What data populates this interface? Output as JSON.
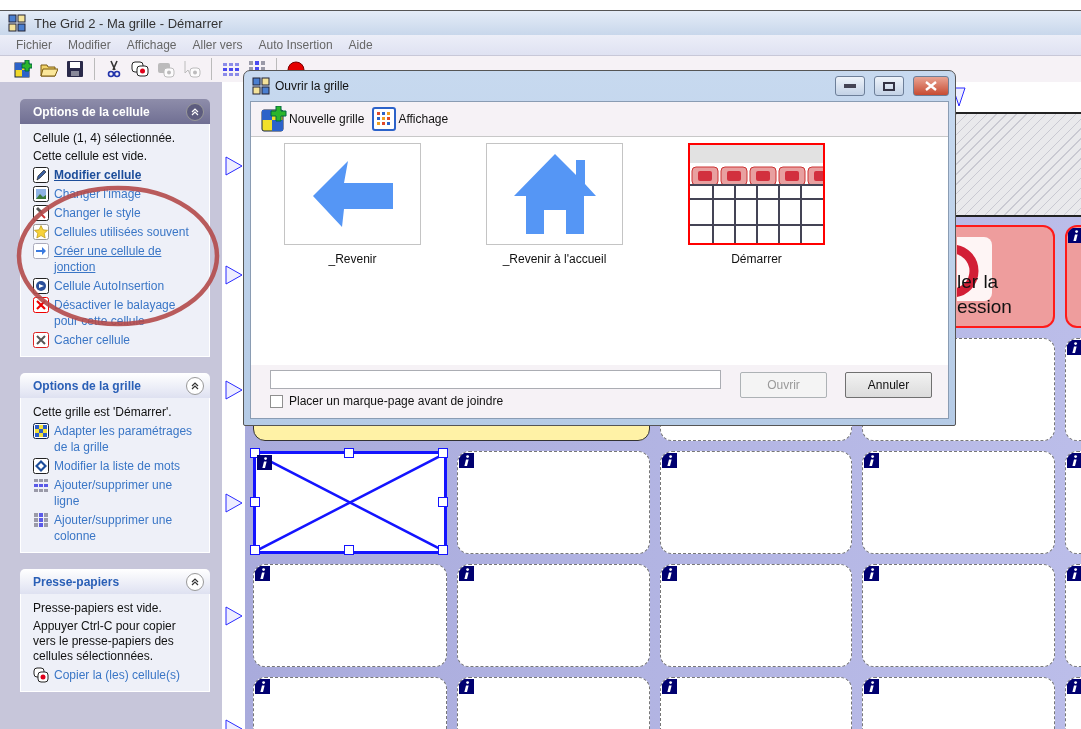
{
  "window": {
    "title": "The Grid 2 - Ma grille - Démarrer"
  },
  "menu": [
    "Fichier",
    "Modifier",
    "Affichage",
    "Aller vers",
    "Auto Insertion",
    "Aide"
  ],
  "toolbar": [
    {
      "kind": "button",
      "disabled": false
    },
    {
      "kind": "button",
      "disabled": false
    },
    {
      "kind": "button",
      "disabled": false
    },
    {
      "kind": "separator"
    },
    {
      "kind": "button",
      "disabled": false
    },
    {
      "kind": "button",
      "disabled": false
    },
    {
      "kind": "button",
      "disabled": true
    },
    {
      "kind": "button",
      "disabled": true
    },
    {
      "kind": "separator"
    },
    {
      "kind": "button",
      "disabled": false
    },
    {
      "kind": "button",
      "disabled": false
    },
    {
      "kind": "separator"
    },
    {
      "kind": "button",
      "disabled": false
    }
  ],
  "sidebar": {
    "panels": [
      {
        "title": "Options de la cellule",
        "focused": true,
        "texts": [
          "Cellule (1, 4) sélectionnée.",
          "Cette cellule est vide."
        ],
        "links": [
          {
            "label": "Modifier cellule",
            "default": true,
            "hovered": false
          },
          {
            "label": "Changer l'image",
            "default": false,
            "hovered": false
          },
          {
            "label": "Changer le style",
            "default": false,
            "hovered": false
          },
          {
            "label": "Cellules utilisées souvent",
            "default": false,
            "hovered": false
          },
          {
            "label": "Créer une cellule de jonction",
            "default": false,
            "hovered": true
          },
          {
            "label": "Cellule AutoInsertion",
            "default": false,
            "hovered": false
          },
          {
            "label": "Désactiver le balayage pour cette cellule",
            "default": false,
            "hovered": false
          },
          {
            "label": "Cacher cellule",
            "default": false,
            "hovered": false
          }
        ]
      },
      {
        "title": "Options de la grille",
        "focused": false,
        "texts": [
          "Cette grille est 'Démarrer'."
        ],
        "links": [
          {
            "label": "Adapter les paramétrages de la grille",
            "default": false,
            "hovered": false
          },
          {
            "label": "Modifier la liste de mots",
            "default": false,
            "hovered": false
          },
          {
            "label": "Ajouter/supprimer une ligne",
            "default": false,
            "hovered": false
          },
          {
            "label": "Ajouter/supprimer une colonne",
            "default": false,
            "hovered": false
          }
        ]
      },
      {
        "title": "Presse-papiers",
        "focused": false,
        "texts": [
          "Presse-papiers est vide.",
          "Appuyer Ctrl-C pour copier vers le presse-papiers des cellules sélectionnées."
        ],
        "links": [
          {
            "label": "Copier la (les) cellule(s)",
            "default": false,
            "hovered": false
          }
        ]
      }
    ]
  },
  "grid": {
    "rows": [
      {
        "cells": [
          {
            "kind": "action",
            "selected": false,
            "text": "ler la\nession"
          },
          {
            "kind": "action",
            "selected": false
          }
        ]
      },
      {
        "cells": [
          {
            "kind": "note",
            "selected": false
          },
          {
            "kind": "empty",
            "selected": false
          },
          {
            "kind": "empty",
            "selected": false
          },
          {
            "kind": "empty",
            "selected": false
          }
        ]
      },
      {
        "cells": [
          {
            "kind": "empty",
            "selected": true
          },
          {
            "kind": "empty",
            "selected": false
          },
          {
            "kind": "empty",
            "selected": false
          },
          {
            "kind": "empty",
            "selected": false
          },
          {
            "kind": "empty",
            "selected": false
          }
        ]
      },
      {
        "cells": [
          {
            "kind": "empty",
            "selected": false
          },
          {
            "kind": "empty",
            "selected": false
          },
          {
            "kind": "empty",
            "selected": false
          },
          {
            "kind": "empty",
            "selected": false
          },
          {
            "kind": "empty",
            "selected": false
          }
        ]
      },
      {
        "cells": [
          {
            "kind": "empty",
            "selected": false
          },
          {
            "kind": "empty",
            "selected": false
          },
          {
            "kind": "empty",
            "selected": false
          },
          {
            "kind": "empty",
            "selected": false
          },
          {
            "kind": "empty",
            "selected": false
          }
        ]
      }
    ]
  },
  "dialog": {
    "title": "Ouvrir la grille",
    "toolbar": [
      "Nouvelle grille",
      "Affichage"
    ],
    "grids": [
      {
        "label": "_Revenir",
        "selected": false
      },
      {
        "label": "_Revenir à l'accueil",
        "selected": false
      },
      {
        "label": "Démarrer",
        "selected": true
      }
    ],
    "bookmark": {
      "label": "Placer un marque-page avant de joindre",
      "checked": false
    },
    "buttons": [
      {
        "label": "Ouvrir",
        "disabled": true
      },
      {
        "label": "Annuler",
        "disabled": false
      }
    ]
  }
}
